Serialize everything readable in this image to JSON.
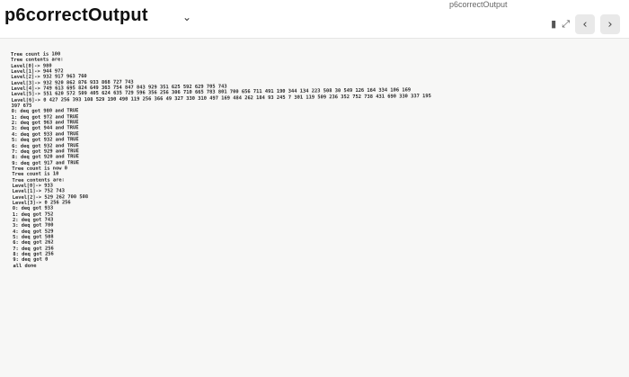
{
  "window": {
    "title": "p6correctOutput",
    "title_chevron": "⌄",
    "top_tab": "p6correctOutput"
  },
  "controls": {
    "icon_a": "▮",
    "icon_b": "⤢",
    "back": "‹",
    "forward": "›"
  },
  "console": {
    "lines": [
      "Tree count is 100",
      "Tree contents are:",
      "Level[0]-> 980",
      "Level[1]-> 944 972",
      "Level[2]-> 932 917 963 760",
      "Level[3]-> 932 920 862 876 933 868 727 743",
      "Level[4]-> 749 613 695 824 649 363 754 847 843 929 351 625 592 629 705 743",
      "Level[5]-> 551 620 572 509 405 624 635 729 596 356 256 306 710 665 783 801 700 656 711 491 190 344 134 223 508 30 549 126 164 334 106 169",
      "Level[6]-> 0 427 256 393 108 529 190 490 119 256 366 49 327 330 310 497 169 484 262 184 93 245 7 301 119 509 236 352 752 738 431 690 330 337 195",
      "397 675",
      "0: deq got 980 and TRUE",
      "1: deq got 972 and TRUE",
      "2: deq got 963 and TRUE",
      "3: deq got 944 and TRUE",
      "4: deq got 933 and TRUE",
      "5: deq got 932 and TRUE",
      "6: deq got 932 and TRUE",
      "7: deq got 929 and TRUE",
      "8: deq got 920 and TRUE",
      "9: deq got 917 and TRUE",
      "Tree count is now 0",
      "Tree count is 10",
      "Tree contents are:",
      "Level[0]-> 933",
      "Level[1]-> 752 743",
      "Level[2]-> 529 262 700 508",
      "Level[3]-> 0 256 256",
      "0: deq got 933",
      "1: deq got 752",
      "2: deq got 743",
      "3: deq got 700",
      "4: deq got 529",
      "5: deq got 508",
      "6: deq got 262",
      "7: deq got 256",
      "8: deq got 256",
      "9: deq got 0",
      "all done"
    ]
  }
}
